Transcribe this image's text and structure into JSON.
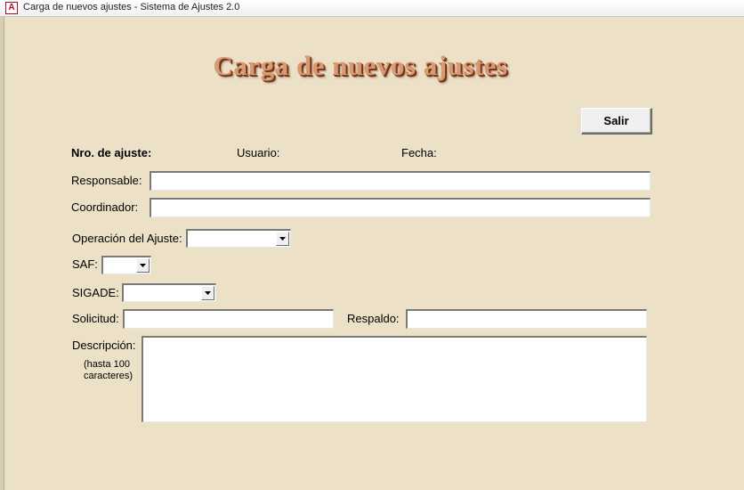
{
  "window": {
    "title": "Carga de nuevos ajustes - Sistema de Ajustes 2.0",
    "app_icon_letter": "A"
  },
  "header": {
    "title": "Carga de nuevos ajustes"
  },
  "buttons": {
    "exit_label": "Salir"
  },
  "info": {
    "nro_label": "Nro. de ajuste:",
    "usuario_label": "Usuario:",
    "fecha_label": "Fecha:"
  },
  "form": {
    "responsable_label": "Responsable:",
    "responsable_value": "",
    "coordinador_label": "Coordinador:",
    "coordinador_value": "",
    "operacion_label": "Operación del Ajuste:",
    "operacion_value": "",
    "saf_label": "SAF:",
    "saf_value": "",
    "sigade_label": "SIGADE:",
    "sigade_value": "",
    "solicitud_label": "Solicitud:",
    "solicitud_value": "",
    "respaldo_label": "Respaldo:",
    "respaldo_value": "",
    "descripcion_label": "Descripción:",
    "descripcion_hint_line1": "(hasta 100",
    "descripcion_hint_line2": "caracteres)",
    "descripcion_value": ""
  },
  "colors": {
    "background": "#ece1c7",
    "title_fill": "#d79b74",
    "title_shadow": "#6e2c13"
  },
  "icons": {
    "app": "access-app-icon",
    "dropdown": "chevron-down-icon"
  }
}
